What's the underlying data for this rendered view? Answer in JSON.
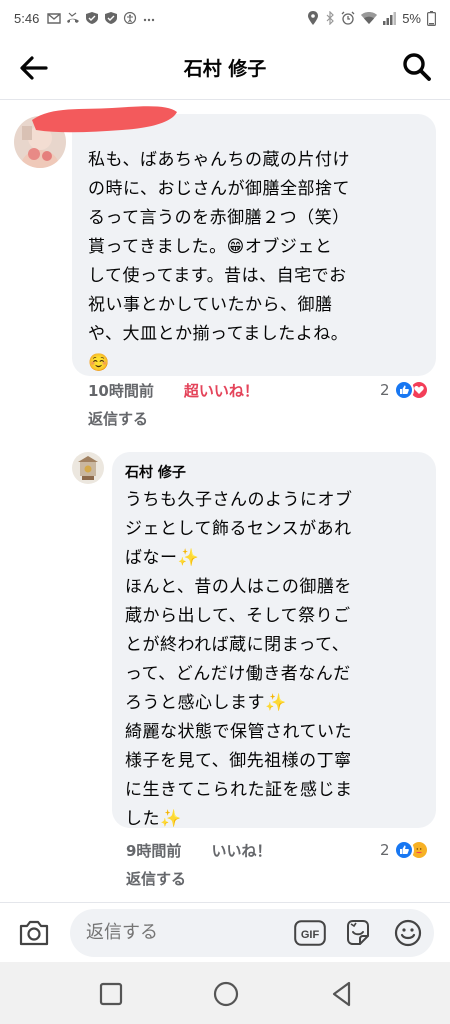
{
  "status_bar": {
    "time": "5:46",
    "battery": "5%",
    "left_icons": [
      "gmail-icon",
      "missed-call-icon",
      "shield-check-icon",
      "shield-check-icon",
      "accessibility-icon",
      "more-dots-icon"
    ],
    "right_icons": [
      "location-icon",
      "bluetooth-icon",
      "alarm-icon",
      "wifi-icon",
      "signal-icon",
      "battery-icon"
    ]
  },
  "header": {
    "title": "石村 修子"
  },
  "comments": [
    {
      "author": "",
      "text": "私も、ばあちゃんちの蔵の片付け\nの時に、おじさんが御膳全部捨て\nるって言うのを赤御膳２つ（笑）\n貰ってきました。😁オブジェと\nして使ってます。昔は、自宅でお\n祝い事とかしていたから、御膳\nや、大皿とか揃ってましたよね。\n☺️",
      "time": "10時間前",
      "like_label": "超いいね！",
      "reply_label": "返信する",
      "reaction_count": "2"
    },
    {
      "author": "石村 修子",
      "text": "うちも久子さんのようにオブ\nジェとして飾るセンスがあれ\nばなー✨\nほんと、昔の人はこの御膳を\n蔵から出して、そして祭りご\nとが終われば蔵に閉まって、\nって、どんだけ働き者なんだ\nろうと感心します✨\n綺麗な状態で保管されていた\n様子を見て、御先祖様の丁寧\nに生きてこられた証を感じま\nした✨",
      "time": "9時間前",
      "like_label": "いいね！",
      "reply_label": "返信する",
      "reaction_count": "2"
    }
  ],
  "composer": {
    "placeholder": "返信する",
    "gif_label": "GIF"
  },
  "colors": {
    "accent_blue": "#1877f2",
    "super_like_red": "#e4445a",
    "bubble_bg": "#f0f2f5",
    "meta_gray": "#65676b"
  }
}
